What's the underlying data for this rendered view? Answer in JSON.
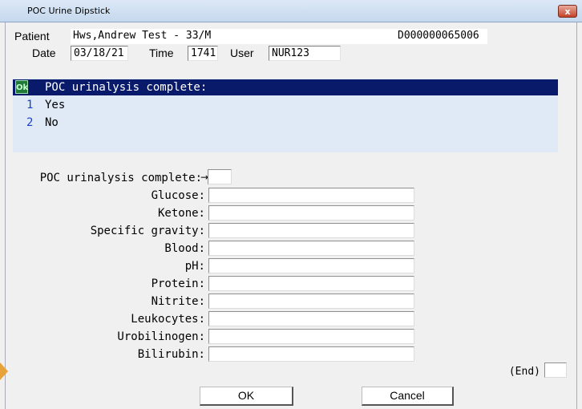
{
  "window": {
    "title": "POC Urine Dipstick",
    "close_label": "x"
  },
  "header": {
    "patient_label": "Patient",
    "patient_value": "Hws,Andrew Test - 33/M",
    "account_number": "D000000065006",
    "date_label": "Date",
    "date_value": "03/18/21",
    "time_label": "Time",
    "time_value": "1741",
    "user_label": "User",
    "user_value": "NUR123"
  },
  "prompt": {
    "badge": "Ok",
    "question": "POC urinalysis complete:",
    "options": [
      {
        "num": "1",
        "text": "Yes"
      },
      {
        "num": "2",
        "text": "No"
      }
    ]
  },
  "form": {
    "first_label": "POC urinalysis complete:",
    "first_arrow": "→",
    "fields": [
      {
        "label": "Glucose:"
      },
      {
        "label": "Ketone:"
      },
      {
        "label": "Specific gravity:"
      },
      {
        "label": "Blood:"
      },
      {
        "label": "pH:"
      },
      {
        "label": "Protein:"
      },
      {
        "label": "Nitrite:"
      },
      {
        "label": "Leukocytes:"
      },
      {
        "label": "Urobilinogen:"
      },
      {
        "label": "Bilirubin:"
      }
    ],
    "end_label": "(End)"
  },
  "buttons": {
    "ok": "OK",
    "cancel": "Cancel"
  }
}
